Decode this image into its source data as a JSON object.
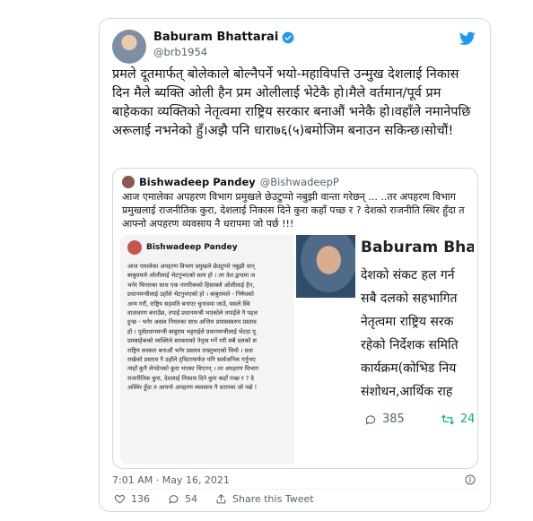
{
  "author": {
    "name": "Baburam Bhattarai",
    "handle": "@brb1954"
  },
  "tweet": {
    "text": "प्रमले दूतमार्फत् बोलेकाले बोल्नैपर्ने भयो-महाविपत्ति उन्मुख देशलाई निकास दिन मैले ब्यक्ति ओली हैन प्रम ओलीलाई भेटेकै हो।मैले वर्तमान/पूर्व प्रम बाहेकका व्यक्तिको नेतृत्वमा राष्ट्रिय सरकार बनाऔं भनेकै हो।वहाँले नमानेपछि अरूलाई नभनेको हुँ।अझै पनि धारा७६(५)बमोजिम बनाउन सकिन्छ।सोचौं!",
    "timestamp": "7:01 AM · May 16, 2021"
  },
  "quote": {
    "name": "Bishwadeep Pandey",
    "handle": "@BishwadeepP",
    "text": "आज एमालेका अपहरण विभाग प्रमुखले छेउटुप्पो नबुझी वान्ता गरेछन् ... ..तर अपहरण विभाग प्रमुखलाई राजनीतिक कुरा, देशलाई निकास दिने कुरा कहाँ पच्छ र ? देशको राजनीति स्थिर हुँदा त आफ्नो अपहरण व्यवसाय नै धरापमा जो पर्छ !!!"
  },
  "image_left": {
    "name": "Bishwadeep Pandey",
    "lines": [
      "आज एमालेका अपहरण विभाग प्रमुखले छेउटुप्पो नबुझी वान्",
      "बाबुरामले ओलीलाई भेटनुभएको सत्य हो । तर देश द्वन्दमा ज",
      "भनेर चिन्ताका साथ एक नागरिकको हिसाबले ओलीलाई हैन,",
      "प्रधानमन्त्रीलाई उहाँले भेटनुभएको हो । बाबुरामले - निषेधको",
      "अन्य गरौं, राष्ट्रिय सहमति बनाएर चुनावमा जाउँ, यसले स्थि",
      "वातावरण बनाउँछ, तपाईं प्रधानमन्त्री भएकोले तपाईंले नै पहल",
      "हुन्छ - भनेर असल नियतका साथ अन्तिम प्रयासस्वरुप प्रस्ताव",
      "हो । पूर्वप्रधानमन्त्री बाबुराम भट्टराईले प्रधानमन्त्रीलाई भेटदा पू",
      "प्रमबाहेकको व्यक्तिले सरकारको नेतृत्व गर्ने गरी सबै दलको स",
      "राष्ट्रिय सरकार बनाऔं भनेर प्रस्ताव राख्नुभएको थियो । प्रधा",
      "राखेको प्रस्ताव नै उहाँले ट्विटरमार्फत पनि सार्वजनिक गर्नुभए",
      "त्यहाँ कुनै लेनदेनको कुरा भएका थिएनन् । तर अपहरण विभाग",
      "राजनीतिक कुरा, देशलाई निकास दिने कुरा कहाँ पच्छ र ? दे",
      "अस्थिर हुँदा त आफ्नो अपहरण व्यवसाय नै धरापमा जो पर्छ !"
    ]
  },
  "image_right": {
    "name": "Baburam Bhatta",
    "lines": [
      "देशको संकट हल गर्न",
      "सबै दलको सहभागित",
      "नेतृत्वमा राष्ट्रिय सरक",
      "रहेको निर्देशक समिति",
      "कार्यक्रम(कोभिड निय",
      "संशोधन,आर्थिक राह"
    ],
    "replies": "385",
    "retweets": "24"
  },
  "actions": {
    "likes": "136",
    "replies": "54",
    "share_label": "Share this Tweet"
  },
  "colors": {
    "twitter_blue": "#1d9bf0",
    "retweet_green": "#00ba7c",
    "muted": "#536471"
  }
}
